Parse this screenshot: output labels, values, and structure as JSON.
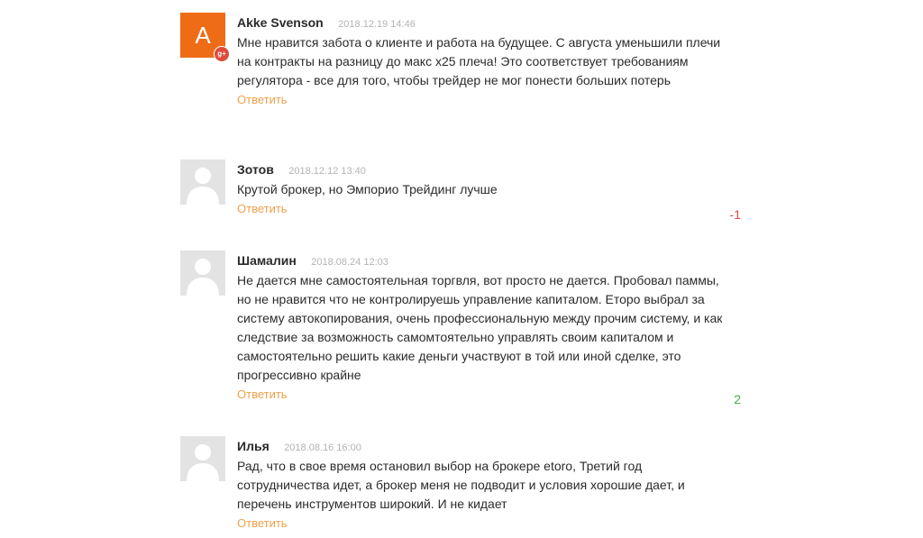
{
  "comments": [
    {
      "author": "Akke Svenson",
      "date": "2018.12.19 14:46",
      "avatar_letter": "A",
      "avatar_color": "#ef6c17",
      "badge": "g+",
      "text": "Мне нравится забота о клиенте и работа на будущее. С августа уменьшили плечи на контракты на разницу до макс х25 плеча! Это соответствует требованиям регулятора - все для того, чтобы трейдер не мог понести больших потерь",
      "reply_label": "Ответить",
      "rating": ""
    },
    {
      "author": "Зотов",
      "date": "2018.12.12 13:40",
      "avatar_icon": "default-user-icon",
      "text": "Крутой брокер, но Эмпорио Трейдинг лучше",
      "reply_label": "Ответить",
      "rating": "-1",
      "rating_color": "#e04848"
    },
    {
      "author": "Шамалин",
      "date": "2018.08.24 12:03",
      "avatar_icon": "default-user-icon",
      "text": "Не дается мне самостоятельная торгвля, вот просто не дается. Пробовал паммы, но не нравится что не контролируешь управление капиталом. Еторо выбрал за систему автокопирования, очень профессиональную между прочим систему, и как следствие за возможность самомтоятельно управлять своим капиталом и самостоятельно решить какие деньги участвуют в той или иной сделке, это прогрессивно крайне",
      "reply_label": "Ответить",
      "rating": "2",
      "rating_color": "#43b043"
    },
    {
      "author": "Илья",
      "date": "2018.08.16 16:00",
      "avatar_icon": "default-user-icon",
      "text": "Рад, что в свое время остановил выбор на брокере etoro, Третий год сотрудничества идет, а брокер меня не подводит и условия хорошие дает, и перечень инструментов широкий. И не кидает",
      "reply_label": "Ответить",
      "rating": ""
    }
  ]
}
